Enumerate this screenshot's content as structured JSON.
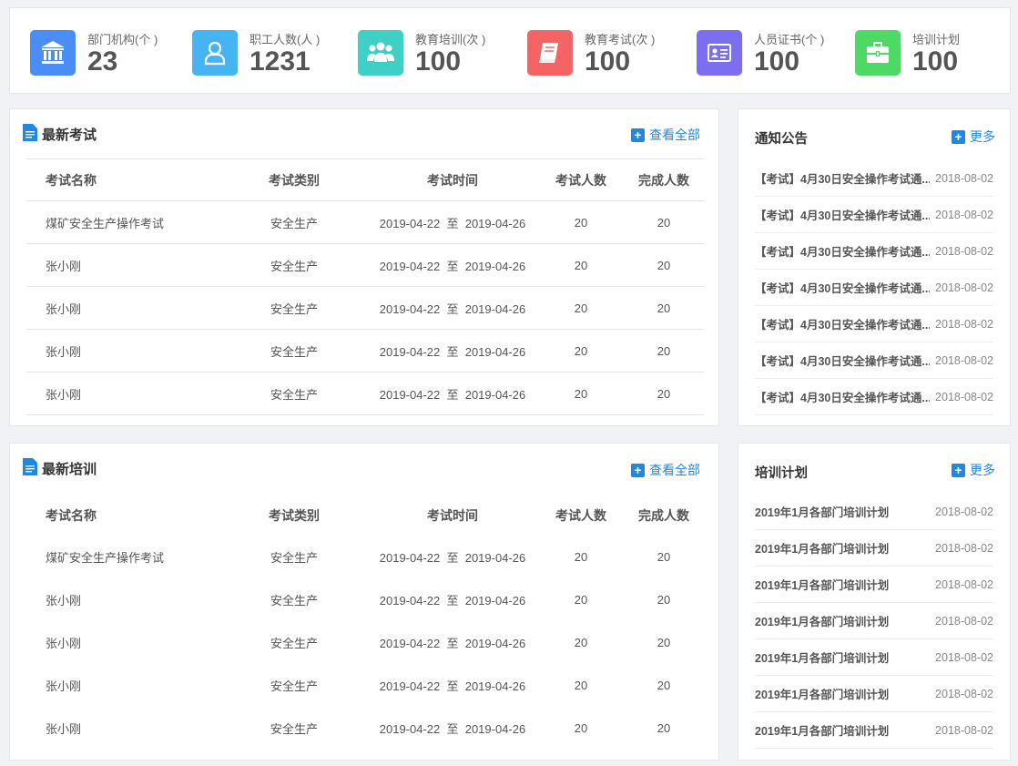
{
  "stats": [
    {
      "label": "部门机构(个 )",
      "value": "23",
      "color": "#4a8ef5",
      "icon": "institution-icon"
    },
    {
      "label": "职工人数(人 )",
      "value": "1231",
      "color": "#45b4f0",
      "icon": "user-icon"
    },
    {
      "label": "教育培训(次 )",
      "value": "100",
      "color": "#3ecfc6",
      "icon": "group-icon"
    },
    {
      "label": "教育考试(次 )",
      "value": "100",
      "color": "#f56465",
      "icon": "book-icon"
    },
    {
      "label": "人员证书(个 )",
      "value": "100",
      "color": "#7b6ff0",
      "icon": "certificate-icon"
    },
    {
      "label": "培训计划",
      "value": "100",
      "color": "#4cd964",
      "icon": "briefcase-icon"
    }
  ],
  "exams": {
    "title": "最新考试",
    "more": "查看全部",
    "headers": [
      "考试名称",
      "考试类别",
      "考试时间",
      "考试人数",
      "完成人数"
    ],
    "rows": [
      {
        "name": "煤矿安全生产操作考试",
        "type": "安全生产",
        "time": "2019-04-22  至  2019-04-26",
        "count": "20",
        "done": "20"
      },
      {
        "name": "张小刚",
        "type": "安全生产",
        "time": "2019-04-22  至  2019-04-26",
        "count": "20",
        "done": "20"
      },
      {
        "name": "张小刚",
        "type": "安全生产",
        "time": "2019-04-22  至  2019-04-26",
        "count": "20",
        "done": "20"
      },
      {
        "name": "张小刚",
        "type": "安全生产",
        "time": "2019-04-22  至  2019-04-26",
        "count": "20",
        "done": "20"
      },
      {
        "name": "张小刚",
        "type": "安全生产",
        "time": "2019-04-22  至  2019-04-26",
        "count": "20",
        "done": "20"
      }
    ]
  },
  "trainings": {
    "title": "最新培训",
    "more": "查看全部",
    "headers": [
      "考试名称",
      "考试类别",
      "考试时间",
      "考试人数",
      "完成人数"
    ],
    "rows": [
      {
        "name": "煤矿安全生产操作考试",
        "type": "安全生产",
        "time": "2019-04-22  至  2019-04-26",
        "count": "20",
        "done": "20"
      },
      {
        "name": "张小刚",
        "type": "安全生产",
        "time": "2019-04-22  至  2019-04-26",
        "count": "20",
        "done": "20"
      },
      {
        "name": "张小刚",
        "type": "安全生产",
        "time": "2019-04-22  至  2019-04-26",
        "count": "20",
        "done": "20"
      },
      {
        "name": "张小刚",
        "type": "安全生产",
        "time": "2019-04-22  至  2019-04-26",
        "count": "20",
        "done": "20"
      },
      {
        "name": "张小刚",
        "type": "安全生产",
        "time": "2019-04-22  至  2019-04-26",
        "count": "20",
        "done": "20"
      }
    ]
  },
  "notices": {
    "title": "通知公告",
    "more": "更多",
    "items": [
      {
        "title": "【考试】4月30日安全操作考试通...",
        "date": "2018-08-02"
      },
      {
        "title": "【考试】4月30日安全操作考试通...",
        "date": "2018-08-02"
      },
      {
        "title": "【考试】4月30日安全操作考试通...",
        "date": "2018-08-02"
      },
      {
        "title": "【考试】4月30日安全操作考试通...",
        "date": "2018-08-02"
      },
      {
        "title": "【考试】4月30日安全操作考试通...",
        "date": "2018-08-02"
      },
      {
        "title": "【考试】4月30日安全操作考试通...",
        "date": "2018-08-02"
      },
      {
        "title": "【考试】4月30日安全操作考试通...",
        "date": "2018-08-02"
      }
    ]
  },
  "plans": {
    "title": "培训计划",
    "more": "更多",
    "items": [
      {
        "title": "2019年1月各部门培训计划",
        "date": "2018-08-02"
      },
      {
        "title": "2019年1月各部门培训计划",
        "date": "2018-08-02"
      },
      {
        "title": "2019年1月各部门培训计划",
        "date": "2018-08-02"
      },
      {
        "title": "2019年1月各部门培训计划",
        "date": "2018-08-02"
      },
      {
        "title": "2019年1月各部门培训计划",
        "date": "2018-08-02"
      },
      {
        "title": "2019年1月各部门培训计划",
        "date": "2018-08-02"
      },
      {
        "title": "2019年1月各部门培训计划",
        "date": "2018-08-02"
      }
    ]
  }
}
